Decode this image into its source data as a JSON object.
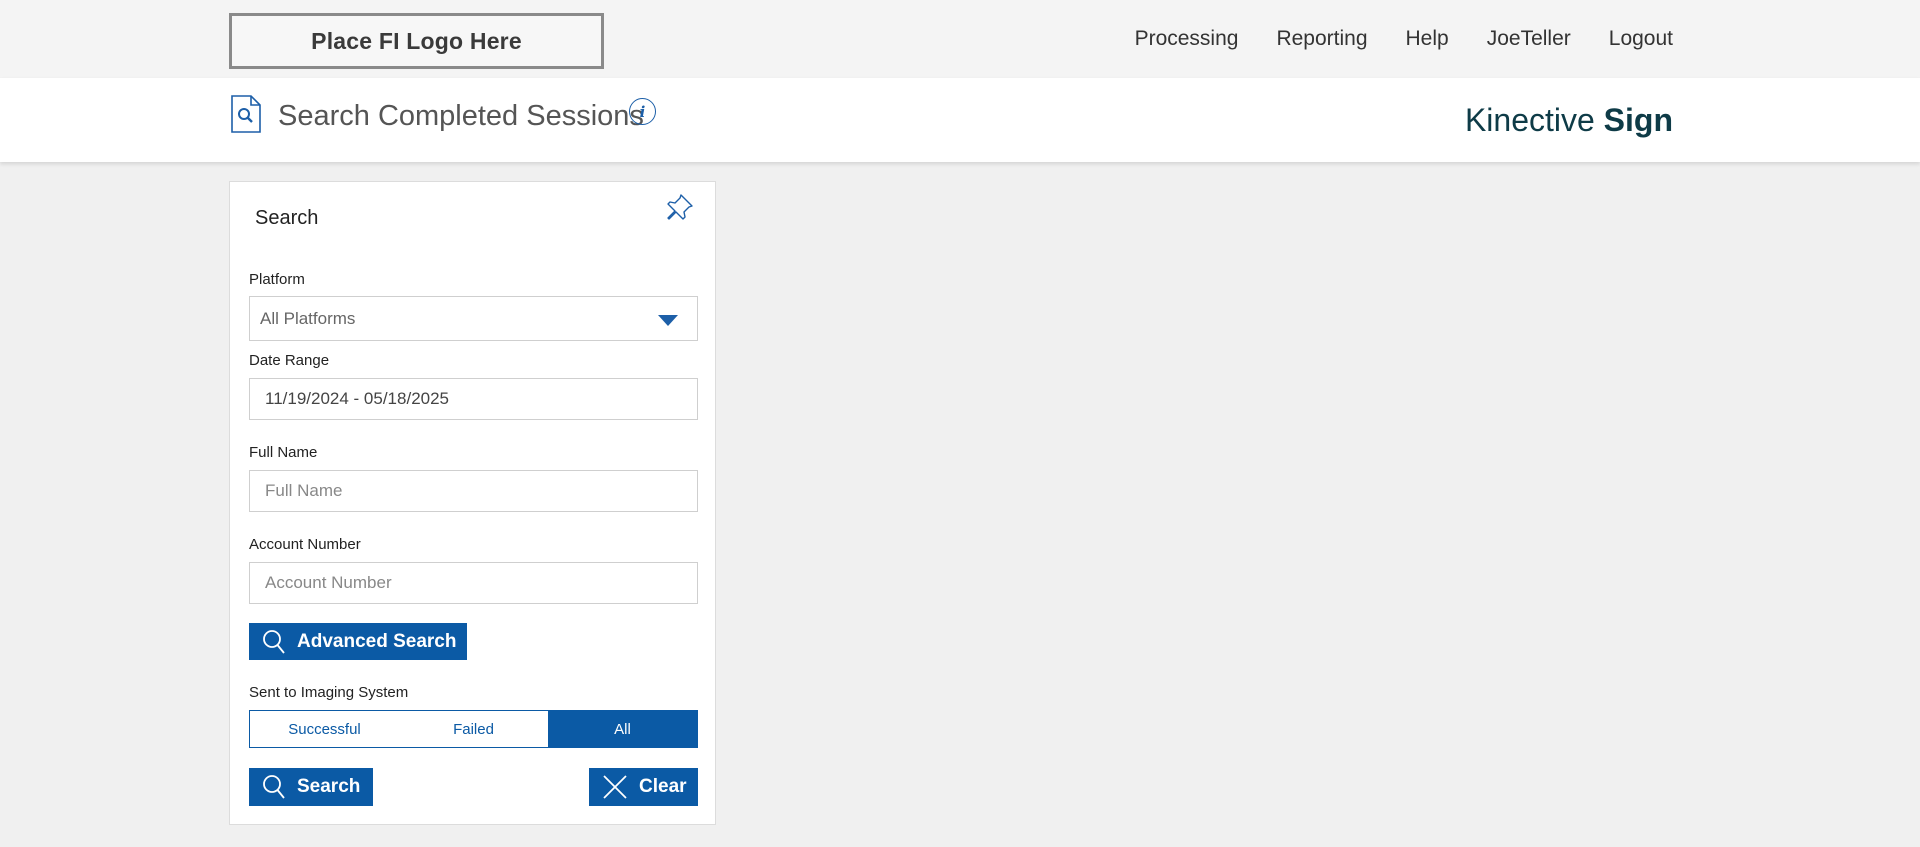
{
  "header": {
    "logo_text": "Place FI Logo Here",
    "nav": [
      "Processing",
      "Reporting",
      "Help",
      "JoeTeller",
      "Logout"
    ]
  },
  "titlebar": {
    "title": "Search Completed Sessions",
    "info_icon": "i",
    "brand_light": "Kinective ",
    "brand_bold": "Sign"
  },
  "search_panel": {
    "title": "Search",
    "platform": {
      "label": "Platform",
      "value": "All Platforms"
    },
    "date_range": {
      "label": "Date Range",
      "value": "11/19/2024 - 05/18/2025"
    },
    "full_name": {
      "label": "Full Name",
      "placeholder": "Full Name"
    },
    "account_number": {
      "label": "Account Number",
      "placeholder": "Account Number"
    },
    "advanced_search_label": "Advanced Search",
    "imaging": {
      "label": "Sent to Imaging System",
      "options": [
        "Successful",
        "Failed",
        "All"
      ],
      "selected": "All"
    },
    "search_button": "Search",
    "clear_button": "Clear"
  },
  "colors": {
    "accent": "#0b5aa5",
    "brand": "#0e3b47",
    "background": "#f0f0f0"
  }
}
